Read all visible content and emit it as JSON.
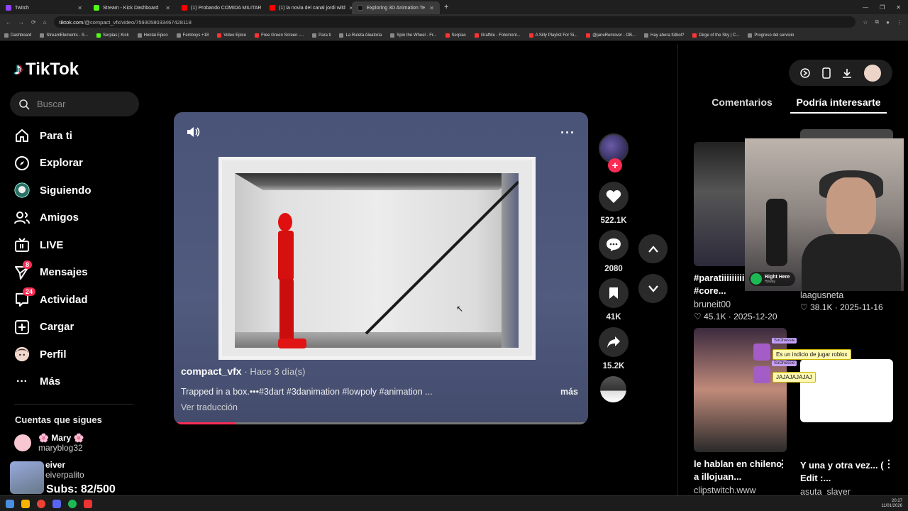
{
  "browser": {
    "tabs": [
      {
        "label": "Twitch",
        "color": "#9146ff"
      },
      {
        "label": "Stream - Kick Dashboard",
        "color": "#53fc18"
      },
      {
        "label": "(1) Probando COMIDA MILITAR",
        "color": "#ff0000"
      },
      {
        "label": "(1) la novia del canal jordi wild",
        "color": "#ff0000"
      },
      {
        "label": "Exploring 3D Animation Te",
        "color": "#111111"
      }
    ],
    "url_host": "tiktok.com",
    "url_path": "/@compact_vfx/video/7593058033467428118",
    "bookmarks": [
      "Dashboard",
      "StreamElements - S...",
      "Serpias | Kick",
      "Hentai Epico",
      "Femboys +18",
      "Video Epico",
      "Free Green Screen -...",
      "Para ti",
      "La Ruleta Aleatoria",
      "Spin the Wheel - Fr...",
      "Serpias",
      "GrafMe - Fotomont...",
      "A Silly Playlist For Si...",
      "@janeRemover - OB...",
      "Hay ahora fútbol?",
      "Dirge of the Sky | C...",
      "Progreso del servicio"
    ]
  },
  "logo": "TikTok",
  "search": {
    "placeholder": "Buscar"
  },
  "nav": [
    {
      "label": "Para ti",
      "icon": "home-icon"
    },
    {
      "label": "Explorar",
      "icon": "compass-icon"
    },
    {
      "label": "Siguiendo",
      "icon": "following-icon"
    },
    {
      "label": "Amigos",
      "icon": "friends-icon"
    },
    {
      "label": "LIVE",
      "icon": "live-icon"
    },
    {
      "label": "Mensajes",
      "icon": "messages-icon",
      "badge": "8"
    },
    {
      "label": "Actividad",
      "icon": "activity-icon",
      "badge": "24"
    },
    {
      "label": "Cargar",
      "icon": "upload-icon"
    },
    {
      "label": "Perfil",
      "icon": "profile-icon"
    },
    {
      "label": "Más",
      "icon": "more-icon"
    }
  ],
  "following": {
    "title": "Cuentas que sigues",
    "accounts": [
      {
        "name": "🌸 Mary 🌸",
        "handle": "maryblog32"
      },
      {
        "name": "eiver",
        "handle": "eiverpalito"
      }
    ]
  },
  "video": {
    "author": "compact_vfx",
    "time": "· Hace 3 día(s)",
    "description": "Trapped in a box.•••#3dart #3danimation #lowpoly #animation ...",
    "more": "más",
    "translate": "Ver traducción",
    "progress": 0.15
  },
  "actions": {
    "likes": "522.1K",
    "comments": "2080",
    "saves": "41K",
    "shares": "15.2K"
  },
  "right_tabs": {
    "comments": "Comentarios",
    "suggested": "Podría interesarte"
  },
  "suggestions": [
    {
      "title": "#paratiiiiiiiiii iiiiiiiii #core...",
      "user": "bruneit00",
      "likes": "45.1K",
      "date": "2025-12-20"
    },
    {
      "title": "",
      "user": "laagusneta",
      "likes": "38.1K",
      "date": "2025-11-16"
    },
    {
      "title": "le hablan en chileno a illojuan...",
      "user": "clipstwitch.www"
    },
    {
      "title": "Y una y otra vez... ( Edit :...",
      "user": "asuta_slayer"
    }
  ],
  "overlay": {
    "song_title": "Right Here",
    "song_artist": "Hyway",
    "chat": [
      {
        "user": "SoOhessie",
        "text": "Es un indicio de jugar roblox"
      },
      {
        "user": "SoOhessie",
        "text": "JAJAJAJAJAJ"
      }
    ],
    "subs": "Subs: 82/500"
  },
  "clock": {
    "time": "20:27",
    "date": "11/01/2026"
  },
  "colors": {
    "accent": "#fe2c55",
    "cyan": "#25f4ee"
  }
}
